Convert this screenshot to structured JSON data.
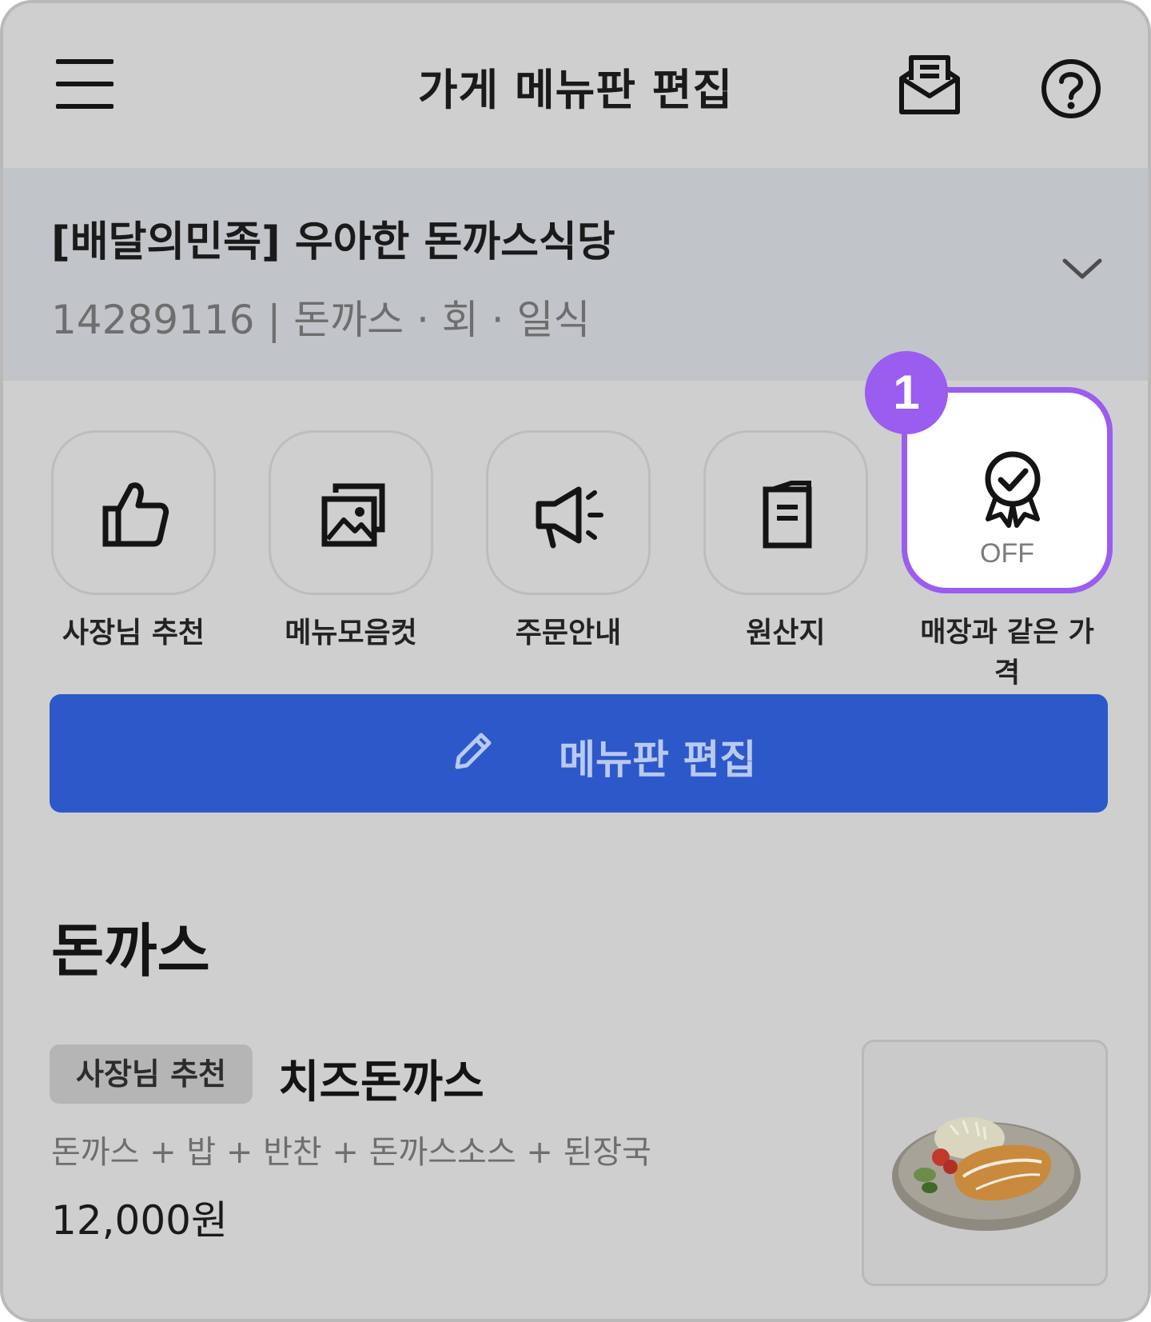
{
  "header": {
    "title": "가게 메뉴판 편집",
    "menu_icon": "hamburger-menu-icon",
    "inbox_icon": "inbox-icon",
    "help_icon": "help-icon"
  },
  "store": {
    "name": "[배달의민족] 우아한 돈까스식당",
    "meta": "14289116 | 돈까스 · 회 · 일식",
    "expand_icon": "chevron-down-icon"
  },
  "features": [
    {
      "label": "사장님 추천",
      "icon": "thumbs-up-icon"
    },
    {
      "label": "메뉴모음컷",
      "icon": "image-gallery-icon"
    },
    {
      "label": "주문안내",
      "icon": "megaphone-icon"
    },
    {
      "label": "원산지",
      "icon": "document-icon"
    },
    {
      "label": "매장과 같은 가격",
      "icon": "certified-badge-icon",
      "status": "OFF"
    }
  ],
  "step_badge": "1",
  "edit_button": {
    "label": "메뉴판 편집",
    "icon": "pencil-icon"
  },
  "section": {
    "title": "돈까스"
  },
  "menu_item": {
    "tag": "사장님 추천",
    "name": "치즈돈까스",
    "description": "돈까스 + 밥 + 반찬 + 돈까스소스 + 된장국",
    "price": "12,000원"
  },
  "colors": {
    "accent_blue": "#2c58c9",
    "highlight_purple": "#9b5cf0",
    "store_band": "#c1c4c9"
  }
}
